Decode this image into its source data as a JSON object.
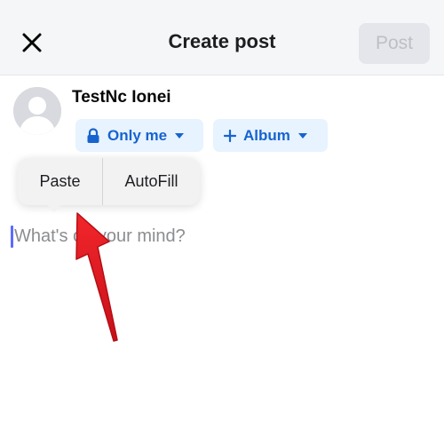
{
  "header": {
    "title": "Create post",
    "post_label": "Post"
  },
  "author": {
    "name": "TestNc Ionei"
  },
  "audience": {
    "privacy_label": "Only me",
    "album_label": "Album"
  },
  "context_menu": {
    "paste_label": "Paste",
    "autofill_label": "AutoFill"
  },
  "composer": {
    "placeholder": "What's on your mind?"
  },
  "colors": {
    "accent": "#1763cf",
    "chip_bg": "#e7f3ff",
    "annotation_arrow": "#e0161d"
  },
  "icons": {
    "close": "close-icon",
    "privacy": "lock-icon",
    "privacy_dropdown": "caret-down-icon",
    "album": "plus-icon",
    "album_dropdown": "caret-down-icon",
    "avatar": "default-avatar-icon"
  }
}
